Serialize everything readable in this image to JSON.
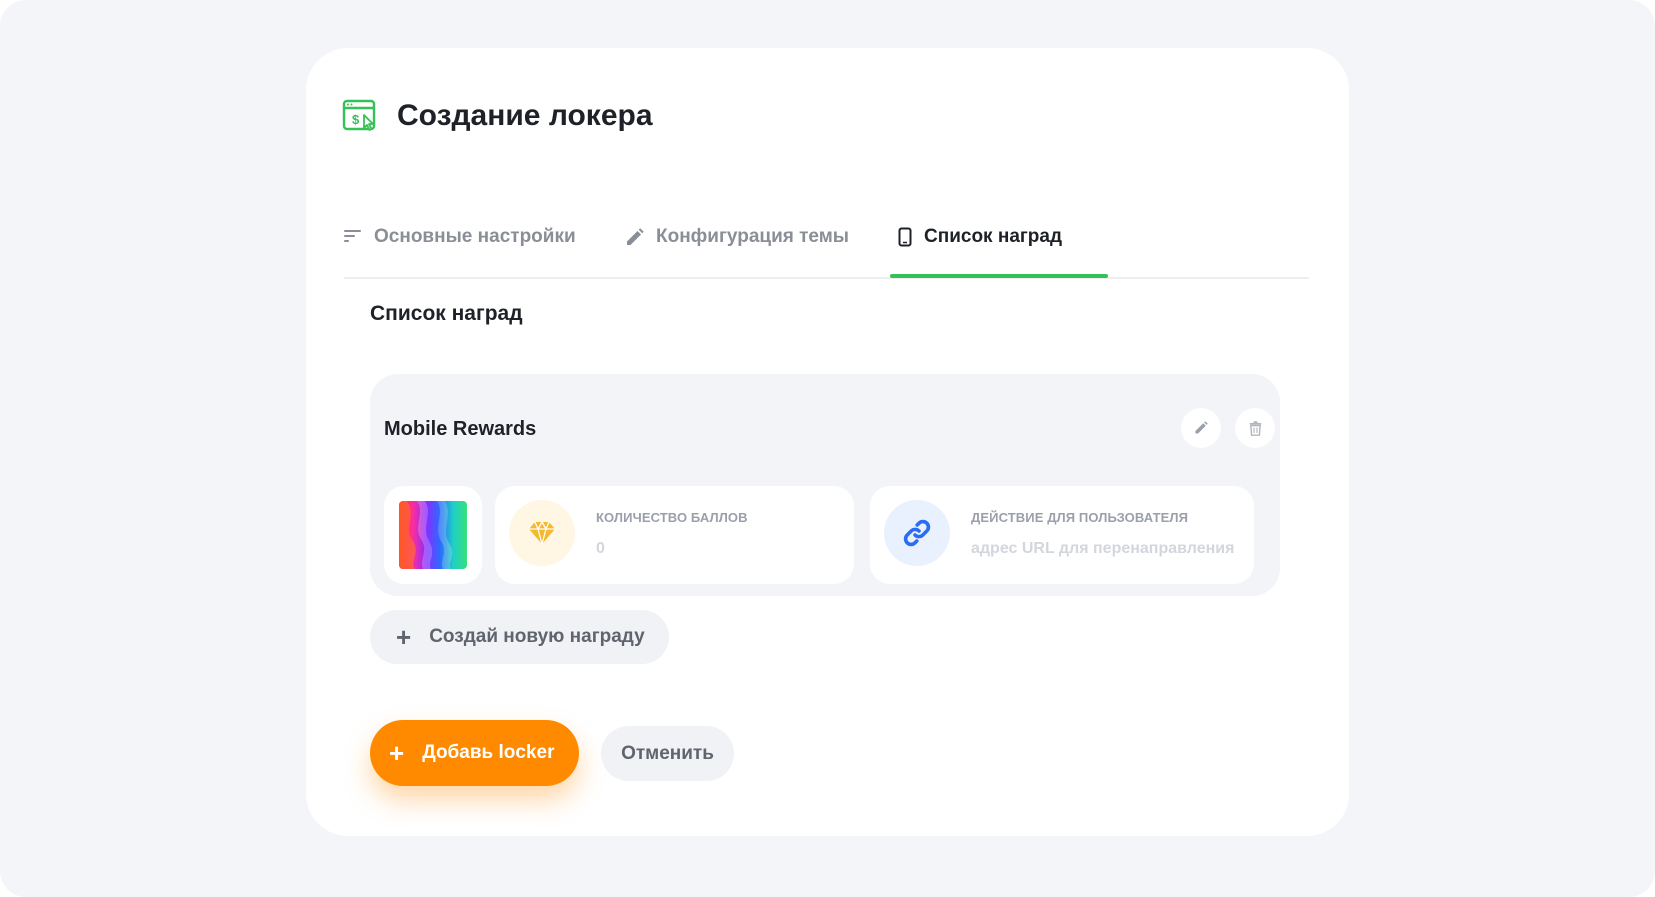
{
  "header": {
    "title": "Создание локера",
    "icon": "browser-dollar-icon",
    "accent_color": "#36c156"
  },
  "tabs": [
    {
      "label": "Основные настройки",
      "icon": "sort-lines-icon",
      "active": false
    },
    {
      "label": "Конфигурация темы",
      "icon": "pencil-icon",
      "active": false
    },
    {
      "label": "Список наград",
      "icon": "smartphone-icon",
      "active": true
    }
  ],
  "section": {
    "title": "Список наград"
  },
  "reward": {
    "name": "Mobile Rewards",
    "points": {
      "label": "Количество баллов",
      "value": "0",
      "icon": "diamond-icon",
      "icon_color": "#f5b82e"
    },
    "action": {
      "label": "Действие для пользователя",
      "placeholder": "адрес URL для перенаправления",
      "icon": "link-icon",
      "icon_color": "#2a6df4"
    }
  },
  "buttons": {
    "create_reward": "Создай новую награду",
    "add_locker": "Добавь locker",
    "cancel": "Отменить",
    "primary_color": "#ff8a00"
  }
}
